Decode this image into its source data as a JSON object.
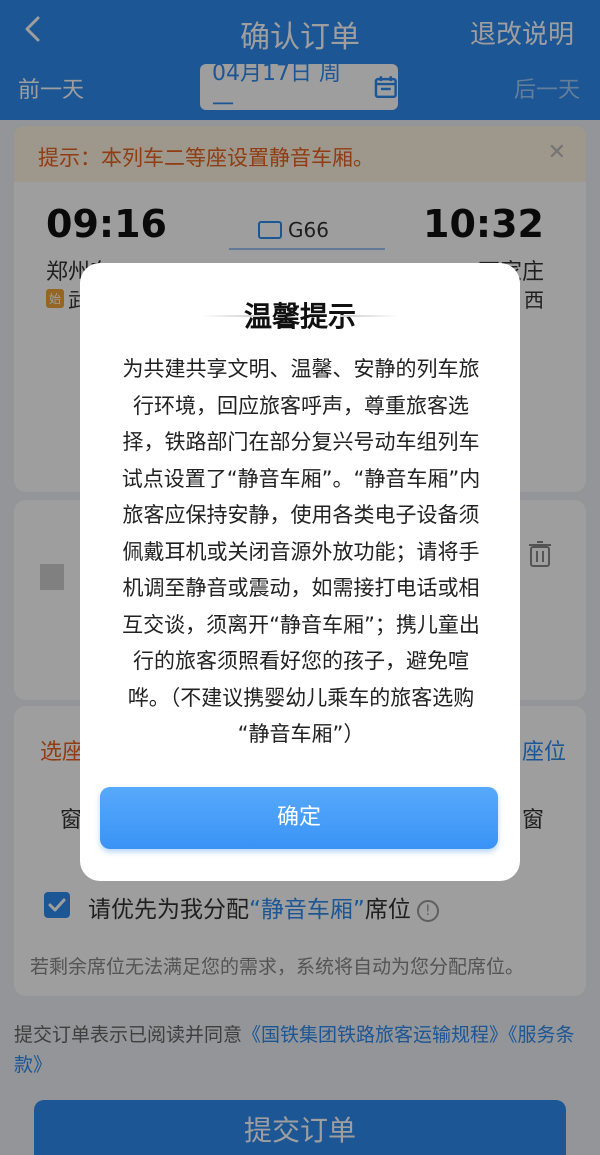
{
  "header": {
    "title": "确认订单",
    "refund_label": "退改说明",
    "prev_day": "前一天",
    "next_day": "后一天",
    "date": "04月17日 周一"
  },
  "notice": {
    "text": "提示：本列车二等座设置静音车厢。"
  },
  "train": {
    "dep_time": "09:16",
    "arr_time": "10:32",
    "number": "G66",
    "dep_station": "郑州东",
    "arr_station": "石家庄",
    "dep_badge": "始",
    "dep_note": "武",
    "arr_note": "西"
  },
  "seat": {
    "label": "选座",
    "right_label": "座位",
    "window_left": "窗",
    "window_right": "窗",
    "pref_prefix": "请优先为我分配",
    "pref_highlight": "“静音车厢”",
    "pref_suffix": "席位",
    "fallback": "若剩余席位无法满足您的需求，系统将自动为您分配席位。"
  },
  "agreement": {
    "prefix": "提交订单表示已阅读并同意",
    "link": "《国铁集团铁路旅客运输规程》《服务条款》"
  },
  "submit_label": "提交订单",
  "modal": {
    "title": "温馨提示",
    "lines": [
      "为共建共享文明、温馨、安静的列车旅",
      "行环境，回应旅客呼声，尊重旅客选",
      "择，铁路部门在部分复兴号动车组列车",
      "试点设置了“静音车厢”。“静音车厢”内",
      "旅客应保持安静，使用各类电子设备须",
      "佩戴耳机或关闭音源外放功能；请将手",
      "机调至静音或震动，如需接打电话或相",
      "互交谈，须离开“静音车厢”；携儿童出",
      "行的旅客须照看好您的孩子，避免喧",
      "哗。（不建议携婴幼儿乘车的旅客选购",
      "“静音车厢”）"
    ],
    "confirm_label": "确定"
  },
  "colors": {
    "primary": "#2f8cf0",
    "warning": "#e8631f"
  },
  "icons": {
    "back": "chevron-left-icon",
    "calendar": "calendar-icon",
    "trash": "trash-icon",
    "info": "info-icon",
    "check": "check-icon"
  }
}
